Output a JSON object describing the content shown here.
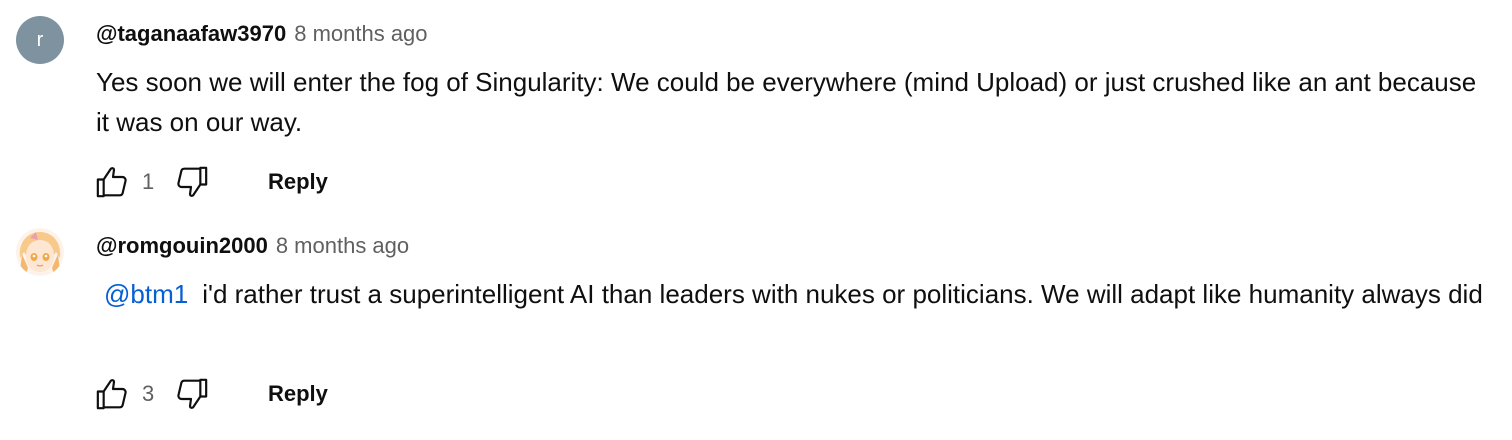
{
  "comments": [
    {
      "avatar_letter": "r",
      "avatar_color": "#7e929f",
      "author": "@taganaafaw3970",
      "time": "8 months ago",
      "text": "Yes soon we will enter the fog of Singularity: We could be everywhere (mind Upload) or just crushed like an ant because it was on our way.",
      "likes": "1",
      "reply_label": "Reply"
    },
    {
      "avatar_image": "anime-avatar",
      "author": "@romgouin2000",
      "time": "8 months ago",
      "mention": "@btm1",
      "text": "i'd rather trust a superintelligent AI than leaders with nukes or politicians. We will adapt like humanity always did",
      "likes": "3",
      "reply_label": "Reply"
    }
  ],
  "icons": {
    "like": "thumbs-up-icon",
    "dislike": "thumbs-down-icon"
  },
  "colors": {
    "mention": "#065fd4",
    "secondary_text": "#606060"
  }
}
